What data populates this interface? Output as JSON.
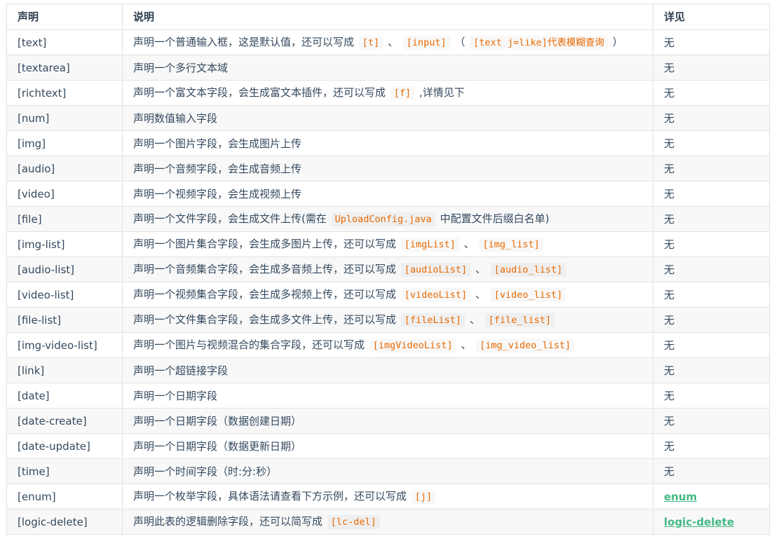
{
  "header": {
    "col1": "声明",
    "col2": "说明",
    "col3": "详见"
  },
  "rows": [
    {
      "key": "[text]",
      "desc": [
        {
          "t": "text",
          "v": "声明一个普通输入框，这是默认值，还可以写成 "
        },
        {
          "t": "code",
          "v": "[t]"
        },
        {
          "t": "text",
          "v": " 、 "
        },
        {
          "t": "code",
          "v": "[input]"
        },
        {
          "t": "text",
          "v": " （ "
        },
        {
          "t": "code",
          "v": "[text j=like]代表模糊查询"
        },
        {
          "t": "text",
          "v": " ）"
        }
      ],
      "ref": "无"
    },
    {
      "key": "[textarea]",
      "desc": [
        {
          "t": "text",
          "v": "声明一个多行文本域"
        }
      ],
      "ref": "无"
    },
    {
      "key": "[richtext]",
      "desc": [
        {
          "t": "text",
          "v": "声明一个富文本字段，会生成富文本插件，还可以写成 "
        },
        {
          "t": "code",
          "v": "[f]"
        },
        {
          "t": "text",
          "v": " ,详情见下"
        }
      ],
      "ref": "无"
    },
    {
      "key": "[num]",
      "desc": [
        {
          "t": "text",
          "v": "声明数值输入字段"
        }
      ],
      "ref": "无"
    },
    {
      "key": "[img]",
      "desc": [
        {
          "t": "text",
          "v": "声明一个图片字段，会生成图片上传"
        }
      ],
      "ref": "无"
    },
    {
      "key": "[audio]",
      "desc": [
        {
          "t": "text",
          "v": "声明一个音频字段，会生成音频上传"
        }
      ],
      "ref": "无"
    },
    {
      "key": "[video]",
      "desc": [
        {
          "t": "text",
          "v": "声明一个视频字段，会生成视频上传"
        }
      ],
      "ref": "无"
    },
    {
      "key": "[file]",
      "desc": [
        {
          "t": "text",
          "v": "声明一个文件字段，会生成文件上传(需在 "
        },
        {
          "t": "code",
          "v": "UploadConfig.java"
        },
        {
          "t": "text",
          "v": " 中配置文件后缀白名单)"
        }
      ],
      "ref": "无"
    },
    {
      "key": "[img-list]",
      "desc": [
        {
          "t": "text",
          "v": "声明一个图片集合字段，会生成多图片上传，还可以写成 "
        },
        {
          "t": "code",
          "v": "[imgList]"
        },
        {
          "t": "text",
          "v": " 、 "
        },
        {
          "t": "code",
          "v": "[img_list]"
        }
      ],
      "ref": "无"
    },
    {
      "key": "[audio-list]",
      "desc": [
        {
          "t": "text",
          "v": "声明一个音频集合字段，会生成多音频上传，还可以写成 "
        },
        {
          "t": "code",
          "v": "[audioList]"
        },
        {
          "t": "text",
          "v": " 、 "
        },
        {
          "t": "code",
          "v": "[audio_list]"
        }
      ],
      "ref": "无"
    },
    {
      "key": "[video-list]",
      "desc": [
        {
          "t": "text",
          "v": "声明一个视频集合字段，会生成多视频上传，还可以写成 "
        },
        {
          "t": "code",
          "v": "[videoList]"
        },
        {
          "t": "text",
          "v": " 、 "
        },
        {
          "t": "code",
          "v": "[video_list]"
        }
      ],
      "ref": "无"
    },
    {
      "key": "[file-list]",
      "desc": [
        {
          "t": "text",
          "v": "声明一个文件集合字段，会生成多文件上传，还可以写成 "
        },
        {
          "t": "code",
          "v": "[fileList]"
        },
        {
          "t": "text",
          "v": " 、 "
        },
        {
          "t": "code",
          "v": "[file_list]"
        }
      ],
      "ref": "无"
    },
    {
      "key": "[img-video-list]",
      "desc": [
        {
          "t": "text",
          "v": "声明一个图片与视频混合的集合字段，还可以写成 "
        },
        {
          "t": "code",
          "v": "[imgVideoList]"
        },
        {
          "t": "text",
          "v": " 、 "
        },
        {
          "t": "code",
          "v": "[img_video_list]"
        }
      ],
      "ref": "无"
    },
    {
      "key": "[link]",
      "desc": [
        {
          "t": "text",
          "v": "声明一个超链接字段"
        }
      ],
      "ref": "无"
    },
    {
      "key": "[date]",
      "desc": [
        {
          "t": "text",
          "v": "声明一个日期字段"
        }
      ],
      "ref": "无"
    },
    {
      "key": "[date-create]",
      "desc": [
        {
          "t": "text",
          "v": "声明一个日期字段（数据创建日期）"
        }
      ],
      "ref": "无"
    },
    {
      "key": "[date-update]",
      "desc": [
        {
          "t": "text",
          "v": "声明一个日期字段（数据更新日期）"
        }
      ],
      "ref": "无"
    },
    {
      "key": "[time]",
      "desc": [
        {
          "t": "text",
          "v": "声明一个时间字段（时:分:秒）"
        }
      ],
      "ref": "无"
    },
    {
      "key": "[enum]",
      "desc": [
        {
          "t": "text",
          "v": "声明一个枚举字段，具体语法请查看下方示例，还可以写成 "
        },
        {
          "t": "code",
          "v": "[j]"
        }
      ],
      "ref": "enum",
      "ref_link": true
    },
    {
      "key": "[logic-delete]",
      "desc": [
        {
          "t": "text",
          "v": "声明此表的逻辑删除字段，还可以简写成 "
        },
        {
          "t": "code",
          "v": "[lc-del]"
        }
      ],
      "ref": "logic-delete",
      "ref_link": true
    }
  ]
}
